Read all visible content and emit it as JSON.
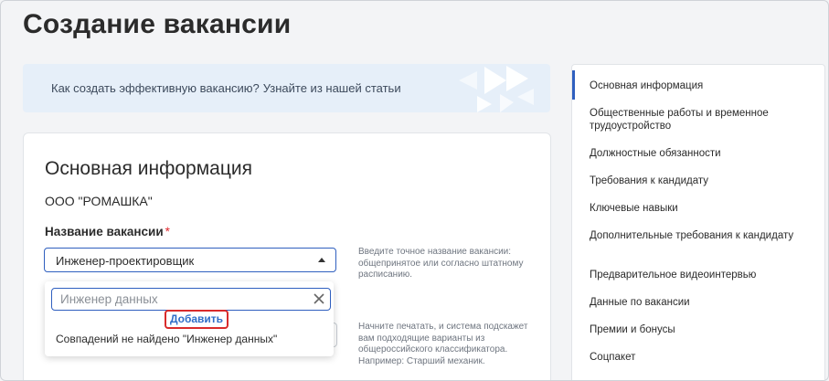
{
  "page": {
    "title": "Создание вакансии"
  },
  "banner": {
    "question": "Как создать эффективную вакансию?",
    "link": "Узнайте из нашей статьи",
    "colors": {
      "background": "#e6eff9",
      "decoration": "#ffffff"
    }
  },
  "form": {
    "section_title": "Основная информация",
    "company": "ООО \"РОМАШКА\"",
    "vacancy_name": {
      "label": "Название вакансии",
      "required_mark": "*",
      "value": "Инженер-проектировщик"
    },
    "hint_name": "Введите точное название вакансии: общепринятое или согласно штатному расписанию.",
    "hint_classifier": "Начните печатать, и система подскажет вам подходящие варианты из общероссийского классификатора. Например: Старший механик."
  },
  "dropdown": {
    "search_value": "Инженер данных",
    "add_label": "Добавить",
    "no_match_text": "Совпадений не найдено \"Инженер данных\""
  },
  "sidebar": {
    "items": [
      {
        "label": "Основная информация",
        "active": true
      },
      {
        "label": "Общественные работы и временное трудоустройство"
      },
      {
        "label": "Должностные обязанности"
      },
      {
        "label": "Требования к кандидату"
      },
      {
        "label": "Ключевые навыки"
      },
      {
        "label": "Дополнительные требования к кандидату"
      },
      {
        "label": "Предварительное видеоинтервью"
      },
      {
        "label": "Данные по вакансии"
      },
      {
        "label": "Премии и бонусы"
      },
      {
        "label": "Соцпакет"
      }
    ]
  },
  "colors": {
    "accent": "#2f5fbf",
    "required": "#e0282e",
    "highlight_box": "#d92b2b",
    "link": "#2f6ec8"
  }
}
